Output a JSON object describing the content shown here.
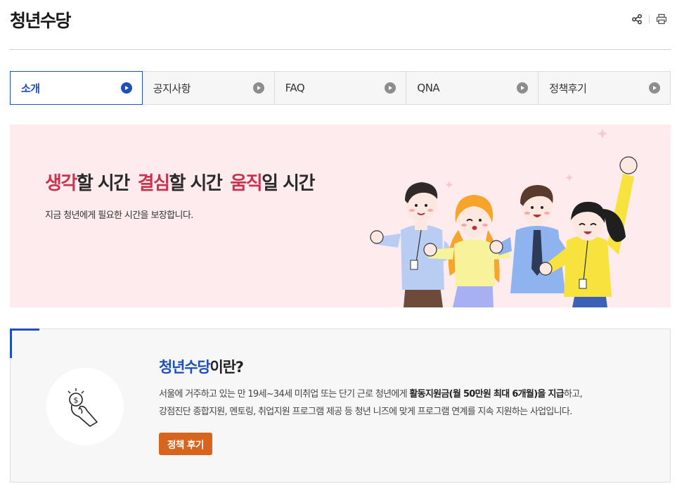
{
  "header": {
    "title": "청년수당",
    "share_icon": "share-icon",
    "print_icon": "print-icon"
  },
  "tabs": [
    {
      "label": "소개",
      "active": true
    },
    {
      "label": "공지사항",
      "active": false
    },
    {
      "label": "FAQ",
      "active": false
    },
    {
      "label": "QNA",
      "active": false
    },
    {
      "label": "정책후기",
      "active": false
    }
  ],
  "banner": {
    "headline": [
      {
        "hl": "생각",
        "rest": "할 시간"
      },
      {
        "hl": "결심",
        "rest": "할 시간"
      },
      {
        "hl": "움직",
        "rest": "일 시간"
      }
    ],
    "subtitle": "지금 청년에게 필요한 시간을 보장합니다."
  },
  "intro": {
    "title_hl": "청년수당",
    "title_rest": "이란?",
    "desc_1": "서울에 거주하고 있는 만 19세~34세 미취업 또는 단기 근로 청년에게 ",
    "desc_bold": "활동지원금(월 50만원 최대 6개월)을 지급",
    "desc_2": "하고,",
    "desc_line2": "강점진단 종합지원, 멘토링, 취업지원 프로그램 제공 등 청년 니즈에 맞게 프로그램 연계를 지속 지원하는 사업입니다.",
    "button_label": "정책 후기",
    "icon": "coin-hand-icon"
  },
  "colors": {
    "accent_blue": "#1f4fb8",
    "highlight_red": "#c8344f",
    "banner_bg": "#fdebee",
    "button_orange": "#d8651e"
  }
}
